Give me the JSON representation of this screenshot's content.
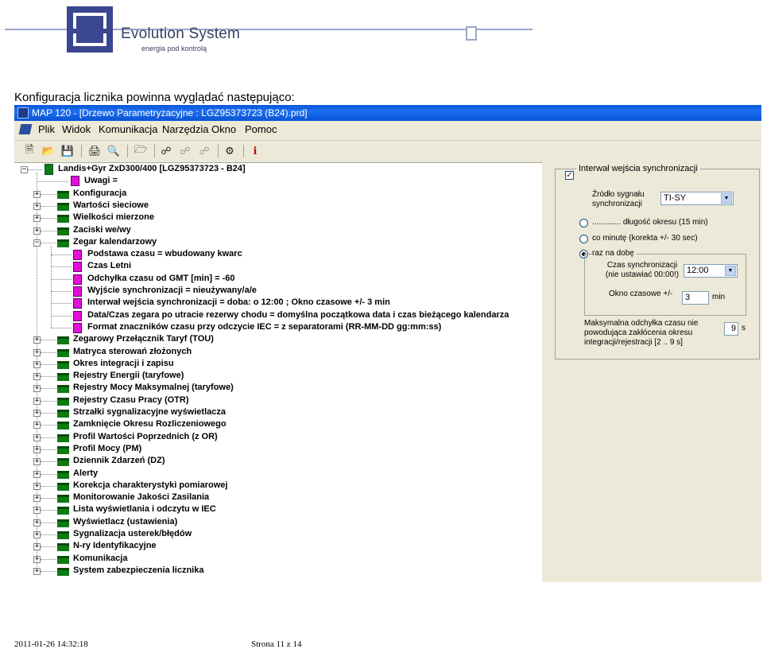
{
  "logo": {
    "title": "Evolution System",
    "subtitle": "energia pod kontrolą"
  },
  "intro_text": "Konfiguracja licznika powinna wyglądać następująco:",
  "window": {
    "title": "MAP 120 - [Drzewo Parametryzacyjne : LGZ95373723 (B24).prd]"
  },
  "menu": [
    "Plik",
    "Widok",
    "Komunikacja",
    "Narzędzia",
    "Okno",
    "Pomoc"
  ],
  "toolbar_icons": [
    "new-icon",
    "open-icon",
    "save-icon",
    "print-icon",
    "print-preview-icon",
    "folder-up-icon",
    "connect-icon",
    "read-icon",
    "write-icon",
    "settings-icon",
    "info-icon"
  ],
  "tree": {
    "root": "Landis+Gyr ZxD300/400 [LGZ95373723 - B24]",
    "top_leaf": "Uwagi =",
    "folders_before": [
      "Konfiguracja",
      "Wartości sieciowe",
      "Wielkości mierzone",
      "Zaciski we/wy"
    ],
    "expanded_folder": "Zegar kalendarzowy",
    "expanded_children": [
      "Podstawa czasu = wbudowany kwarc",
      "Czas Letni",
      "Odchyłka czasu od GMT [min] = -60",
      "Wyjście synchronizacji = nieużywany/a/e",
      "Interwał wejścia synchronizacji = doba: o 12:00 ; Okno czasowe +/- 3 min",
      "Data/Czas zegara po utracie rezerwy chodu = domyślna początkowa data i czas bieżącego kalendarza",
      "Format znaczników czasu przy odczycie IEC = z separatorami (RR-MM-DD gg:mm:ss)"
    ],
    "folders_after": [
      "Zegarowy Przełącznik Taryf (TOU)",
      "Matryca sterowań złożonych",
      "Okres integracji i zapisu",
      "Rejestry Energii (taryfowe)",
      "Rejestry Mocy Maksymalnej (taryfowe)",
      "Rejestry Czasu Pracy (OTR)",
      "Strzałki sygnalizacyjne wyświetlacza",
      "Zamknięcie Okresu Rozliczeniowego",
      "Profil Wartości Poprzednich (z OR)",
      "Profil Mocy (PM)",
      "Dziennik Zdarzeń (DZ)",
      "Alerty",
      "Korekcja charakterystyki pomiarowej",
      "Monitorowanie Jakości Zasilania",
      "Lista wyświetlania i odczytu w IEC",
      "Wyświetlacz (ustawienia)",
      "Sygnalizacja usterek/błędów",
      "N-ry Identyfikacyjne",
      "Komunikacja",
      "System zabezpieczenia licznika"
    ]
  },
  "panel": {
    "group_title": "Interwał wejścia synchronizacji",
    "group_checked": true,
    "source_label": "Źródło sygnału synchronizacji",
    "source_value": "TI-SY",
    "radio1": "............. długość okresu  (15 min)",
    "radio2": "co minutę (korekta +/- 30 sec)",
    "radio3": "raz na dobę",
    "selected_radio": 3,
    "sync_time_label": "Czas synchronizacji (nie ustawiać 00:00!)",
    "sync_time_value": "12:00",
    "window_label": "Okno czasowe +/-",
    "window_value": "3",
    "window_unit": "min",
    "max_dev_label": "Maksymalna odchyłka czasu nie powodująca zakłócenia okresu integracji/rejestracji  [2 .. 9 s]",
    "max_dev_value": "9",
    "max_dev_unit": "s"
  },
  "footer": {
    "date": "2011-01-26 14:32:18",
    "page": "Strona 11 z 14"
  }
}
